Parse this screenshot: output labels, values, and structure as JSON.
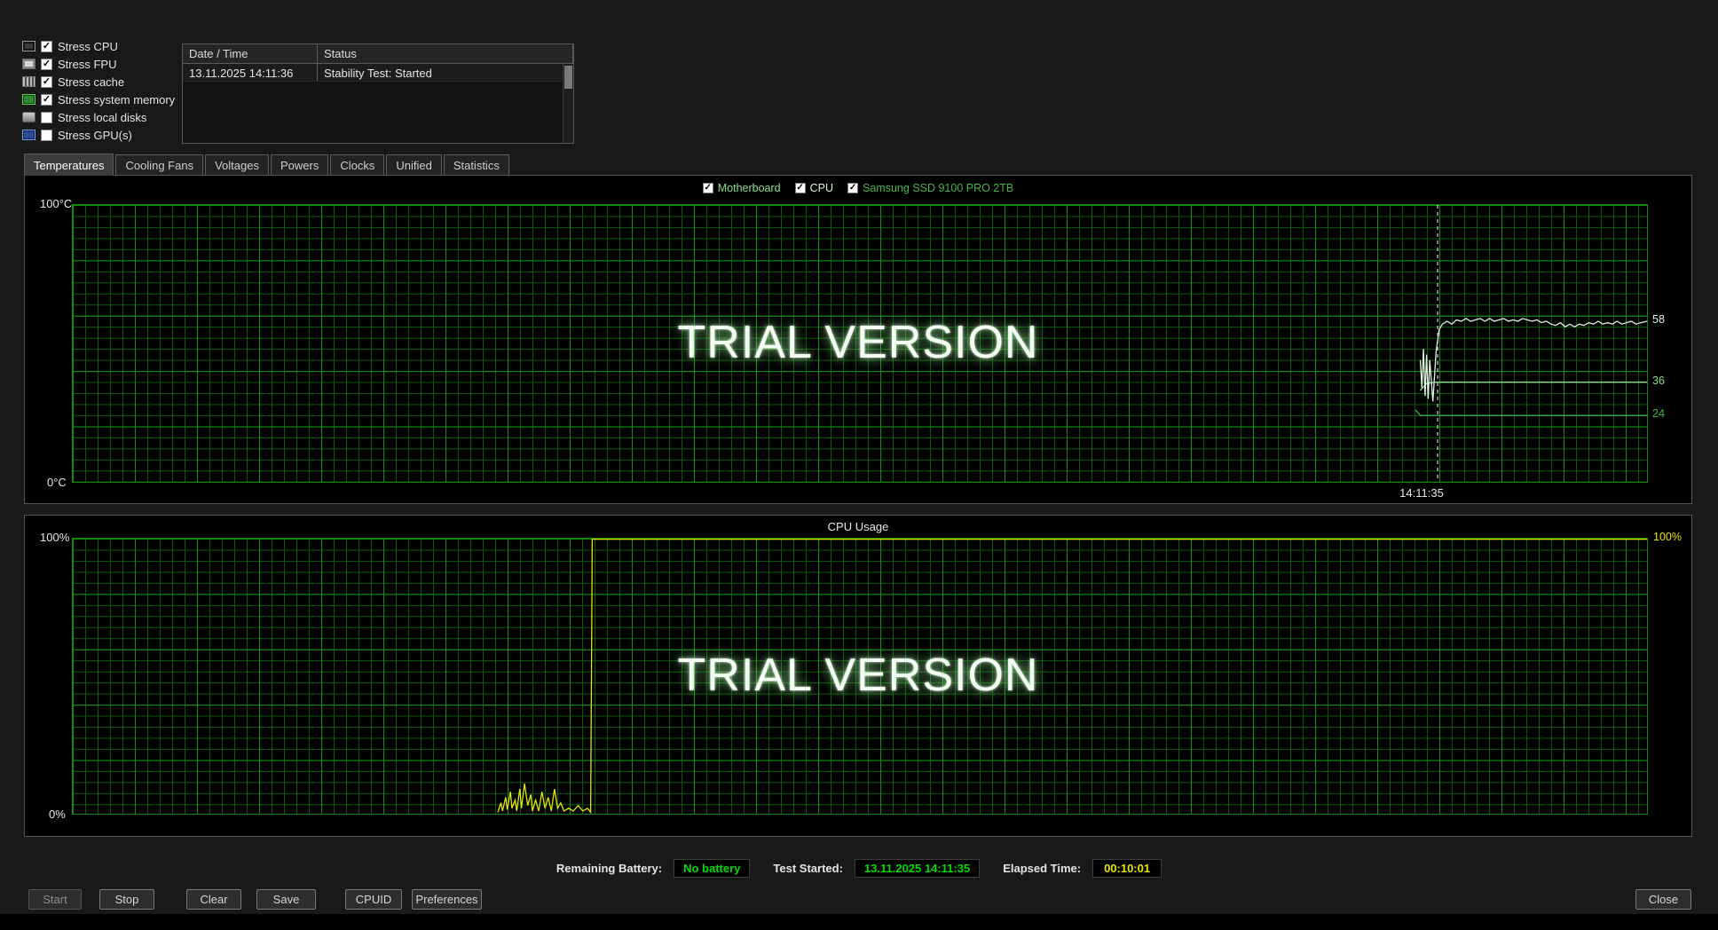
{
  "watermark": "TRIAL VERSION",
  "stress_options": {
    "items": [
      {
        "label": "Stress CPU",
        "checked": true,
        "icon": "cpu-icon"
      },
      {
        "label": "Stress FPU",
        "checked": true,
        "icon": "fpu-icon"
      },
      {
        "label": "Stress cache",
        "checked": true,
        "icon": "cache-icon"
      },
      {
        "label": "Stress system memory",
        "checked": true,
        "icon": "memory-icon"
      },
      {
        "label": "Stress local disks",
        "checked": false,
        "icon": "disk-icon"
      },
      {
        "label": "Stress GPU(s)",
        "checked": false,
        "icon": "gpu-icon"
      }
    ]
  },
  "log": {
    "columns": [
      "Date / Time",
      "Status"
    ],
    "rows": [
      {
        "datetime": "13.11.2025 14:11:36",
        "status": "Stability Test: Started"
      }
    ]
  },
  "tabs": {
    "active": "Temperatures",
    "items": [
      "Temperatures",
      "Cooling Fans",
      "Voltages",
      "Powers",
      "Clocks",
      "Unified",
      "Statistics"
    ]
  },
  "chart_data": [
    {
      "type": "line",
      "title": "Temperatures",
      "axis": {
        "top_label": "100°C",
        "bottom_label": "0°C",
        "ylim": [
          0,
          100
        ]
      },
      "legend": [
        {
          "label": "Motherboard",
          "color": "#8be08b",
          "checked": true
        },
        {
          "label": "CPU",
          "color": "#dff5df",
          "checked": true
        },
        {
          "label": "Samsung SSD 9100 PRO 2TB",
          "color": "#49b449",
          "checked": true
        }
      ],
      "cursor": {
        "x": 0.867,
        "label": "14:11:35"
      },
      "right_labels": [
        {
          "text": "58",
          "value": 58,
          "color": "#dff5df"
        },
        {
          "text": "36",
          "value": 36,
          "color": "#8be08b"
        },
        {
          "text": "24",
          "value": 24,
          "color": "#49b449"
        }
      ],
      "series": [
        {
          "name": "Motherboard",
          "color": "#8be08b",
          "points": [
            [
              0.856,
              33
            ],
            [
              0.86,
              35.5
            ],
            [
              0.865,
              36
            ],
            [
              1,
              36
            ]
          ]
        },
        {
          "name": "Samsung SSD 9100 PRO 2TB",
          "color": "#49b449",
          "points": [
            [
              0.853,
              26
            ],
            [
              0.856,
              24
            ],
            [
              1,
              24
            ]
          ]
        },
        {
          "name": "CPU",
          "color": "#dff5df",
          "points": [
            [
              0.856,
              44
            ],
            [
              0.857,
              34
            ],
            [
              0.858,
              48
            ],
            [
              0.859,
              31
            ],
            [
              0.86,
              46
            ],
            [
              0.861,
              30
            ],
            [
              0.862,
              44
            ],
            [
              0.864,
              29
            ],
            [
              0.866,
              47
            ],
            [
              0.868,
              55
            ],
            [
              0.87,
              57
            ],
            [
              0.873,
              58
            ],
            [
              0.876,
              57
            ],
            [
              0.879,
              58.5
            ],
            [
              0.882,
              58
            ],
            [
              0.885,
              59
            ],
            [
              0.888,
              58
            ],
            [
              0.891,
              58.5
            ],
            [
              0.894,
              59
            ],
            [
              0.897,
              58
            ],
            [
              0.9,
              59
            ],
            [
              0.903,
              58
            ],
            [
              0.906,
              58.5
            ],
            [
              0.909,
              59
            ],
            [
              0.912,
              58
            ],
            [
              0.915,
              58.5
            ],
            [
              0.918,
              58
            ],
            [
              0.921,
              59
            ],
            [
              0.924,
              58.5
            ],
            [
              0.927,
              58
            ],
            [
              0.93,
              58.5
            ],
            [
              0.933,
              57.5
            ],
            [
              0.936,
              58
            ],
            [
              0.939,
              57
            ],
            [
              0.942,
              56.5
            ],
            [
              0.945,
              57.5
            ],
            [
              0.948,
              56
            ],
            [
              0.951,
              57
            ],
            [
              0.954,
              56
            ],
            [
              0.957,
              57
            ],
            [
              0.96,
              56.5
            ],
            [
              0.963,
              57.5
            ],
            [
              0.966,
              57
            ],
            [
              0.969,
              58
            ],
            [
              0.972,
              57
            ],
            [
              0.975,
              57.5
            ],
            [
              0.978,
              57
            ],
            [
              0.981,
              58
            ],
            [
              0.984,
              57
            ],
            [
              0.987,
              57.5
            ],
            [
              0.99,
              58
            ],
            [
              0.993,
              57
            ],
            [
              0.996,
              57.5
            ],
            [
              1,
              58
            ]
          ]
        }
      ]
    },
    {
      "type": "line",
      "title": "CPU Usage",
      "axis": {
        "top_label": "100%",
        "bottom_label": "0%",
        "ylim": [
          0,
          100
        ]
      },
      "right_label": {
        "text": "100%",
        "value": 100,
        "color": "#e6e600"
      },
      "series": [
        {
          "name": "CPU Usage",
          "color": "#e6e600",
          "points": [
            [
              0.27,
              0.5
            ],
            [
              0.272,
              4
            ],
            [
              0.273,
              1
            ],
            [
              0.275,
              6
            ],
            [
              0.276,
              1.5
            ],
            [
              0.278,
              8
            ],
            [
              0.279,
              2
            ],
            [
              0.281,
              5
            ],
            [
              0.282,
              1
            ],
            [
              0.284,
              9
            ],
            [
              0.285,
              2
            ],
            [
              0.287,
              11
            ],
            [
              0.289,
              3
            ],
            [
              0.291,
              7
            ],
            [
              0.292,
              1
            ],
            [
              0.294,
              5
            ],
            [
              0.296,
              1
            ],
            [
              0.298,
              8
            ],
            [
              0.3,
              2
            ],
            [
              0.302,
              6
            ],
            [
              0.304,
              1
            ],
            [
              0.306,
              9
            ],
            [
              0.308,
              2
            ],
            [
              0.31,
              4
            ],
            [
              0.312,
              1
            ],
            [
              0.315,
              2
            ],
            [
              0.318,
              1
            ],
            [
              0.321,
              3
            ],
            [
              0.324,
              1
            ],
            [
              0.327,
              2
            ],
            [
              0.329,
              0.5
            ],
            [
              0.33,
              99.8
            ],
            [
              1,
              99.8
            ]
          ]
        }
      ]
    }
  ],
  "status_bar": {
    "remaining_battery_label": "Remaining Battery:",
    "remaining_battery_value": "No battery",
    "test_started_label": "Test Started:",
    "test_started_value": "13.11.2025 14:11:35",
    "elapsed_label": "Elapsed Time:",
    "elapsed_value": "00:10:01",
    "green": "#00dc00",
    "yellow": "#e6e600"
  },
  "buttons": {
    "start": "Start",
    "stop": "Stop",
    "clear": "Clear",
    "save": "Save",
    "cpuid": "CPUID",
    "preferences": "Preferences",
    "close": "Close"
  }
}
